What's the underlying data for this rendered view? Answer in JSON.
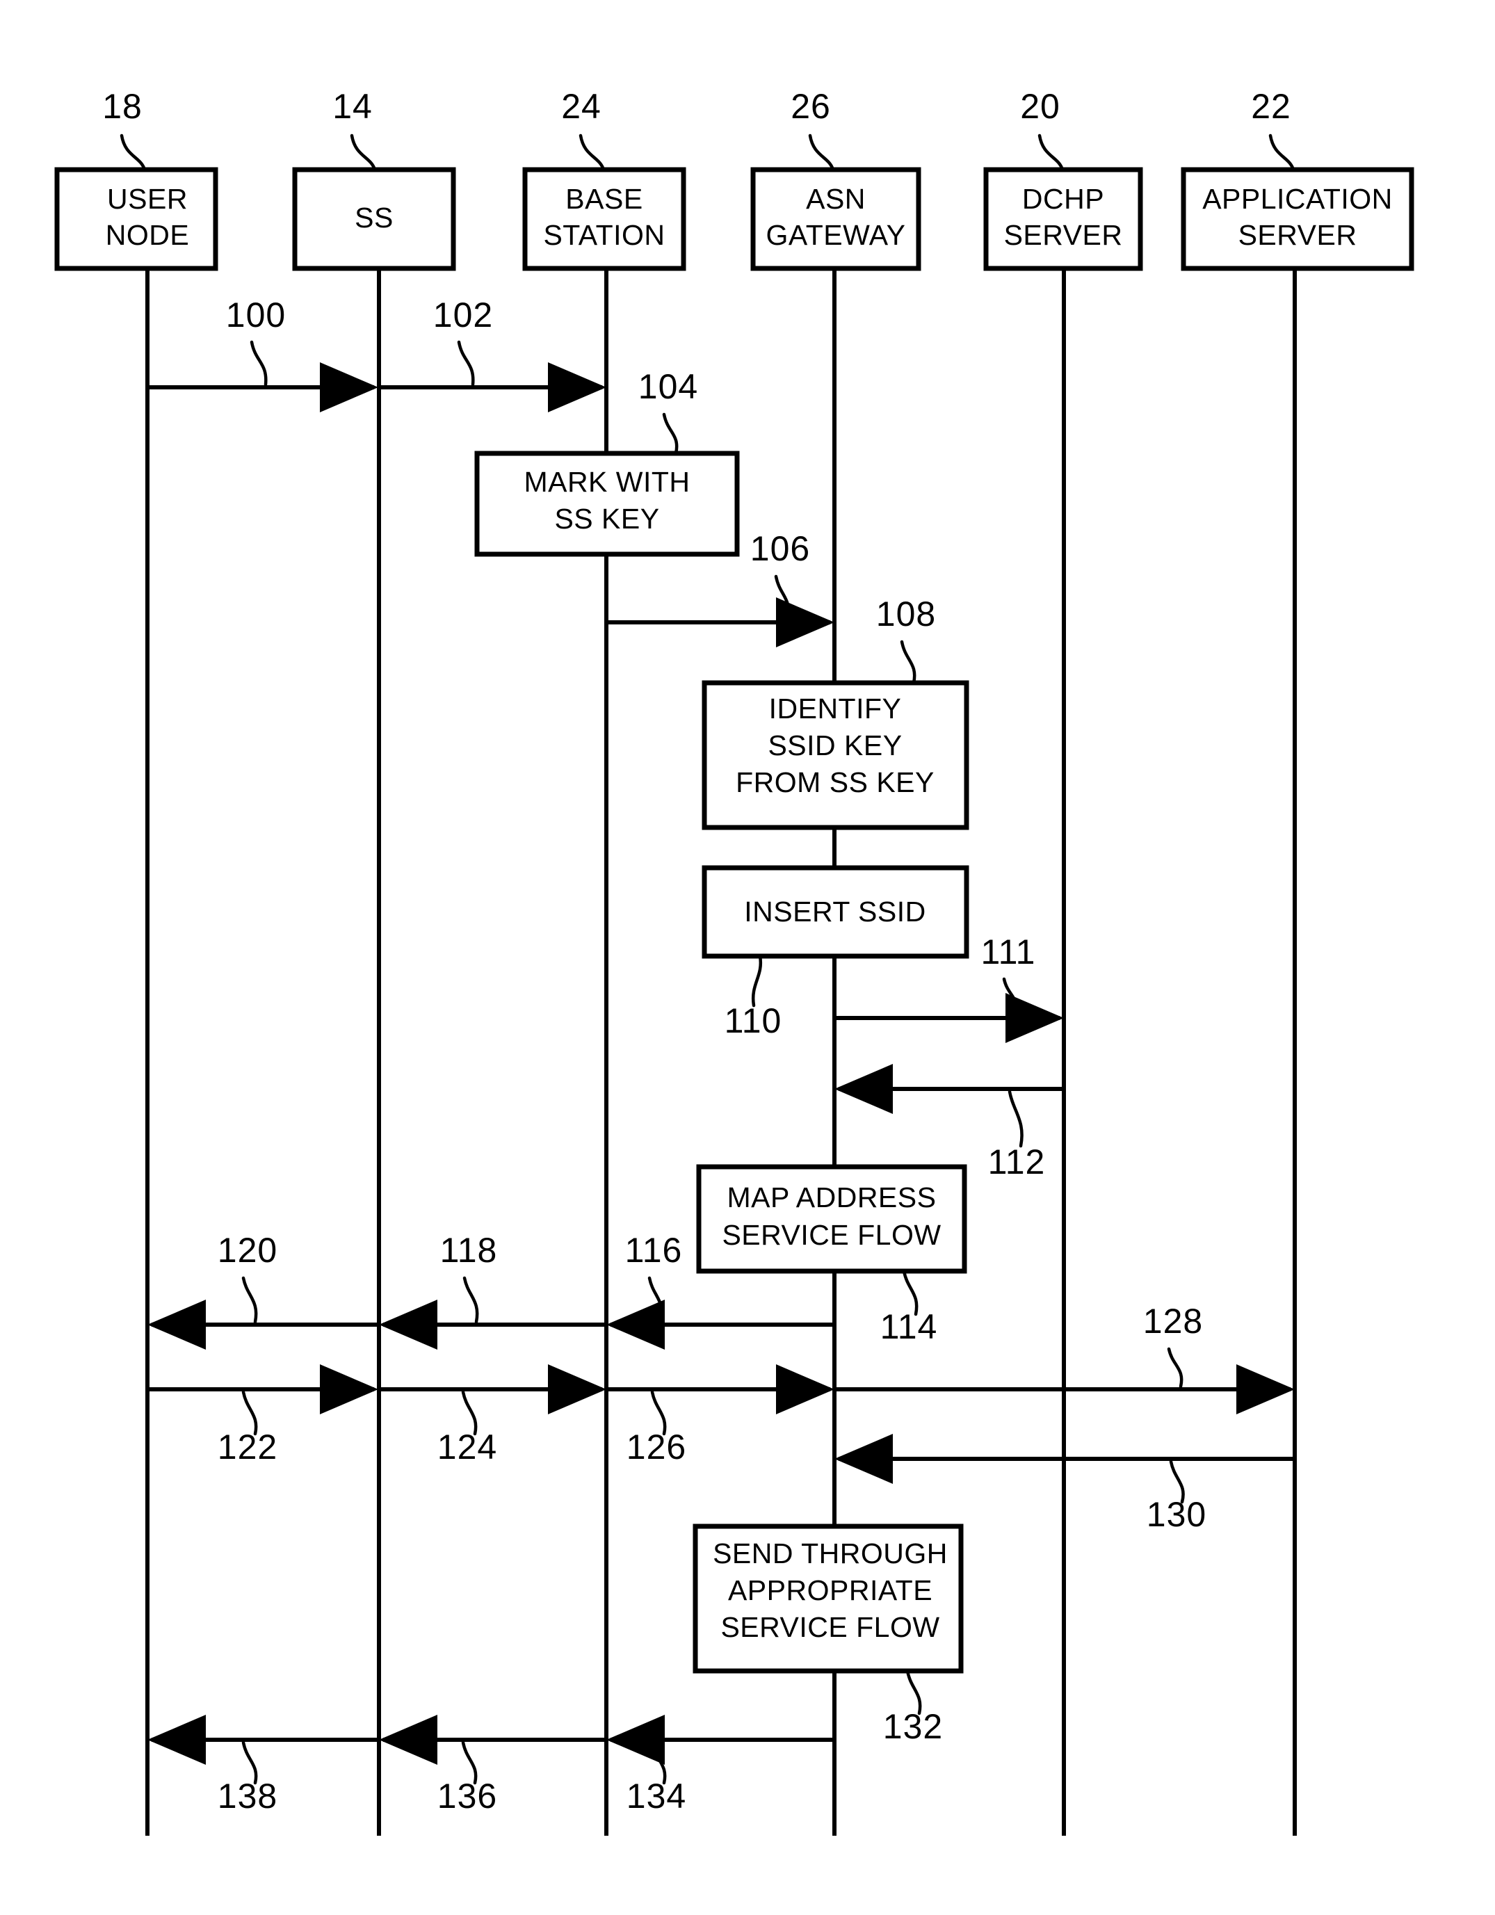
{
  "figure": {
    "type": "sequence-diagram",
    "kind": "patent-drawing",
    "background_color": "#ffffff",
    "line_color": "#000000"
  },
  "lifelines": [
    {
      "ref": "18",
      "label_line1": "USER",
      "label_line2": "NODE"
    },
    {
      "ref": "14",
      "label_line1": "SS",
      "label_line2": ""
    },
    {
      "ref": "24",
      "label_line1": "BASE",
      "label_line2": "STATION"
    },
    {
      "ref": "26",
      "label_line1": "ASN",
      "label_line2": "GATEWAY"
    },
    {
      "ref": "20",
      "label_line1": "DCHP",
      "label_line2": "SERVER"
    },
    {
      "ref": "22",
      "label_line1": "APPLICATION",
      "label_line2": "SERVER"
    }
  ],
  "process_boxes": [
    {
      "ref": "104",
      "lines": [
        "MARK WITH",
        "SS KEY"
      ]
    },
    {
      "ref": "108",
      "lines": [
        "IDENTIFY",
        "SSID KEY",
        "FROM SS KEY"
      ]
    },
    {
      "ref": "110",
      "lines": [
        "INSERT SSID"
      ]
    },
    {
      "ref": "114",
      "lines": [
        "MAP ADDRESS",
        "SERVICE FLOW"
      ]
    },
    {
      "ref": "132",
      "lines": [
        "SEND THROUGH",
        "APPROPRIATE",
        "SERVICE FLOW"
      ]
    }
  ],
  "messages": [
    {
      "ref": "100",
      "from": "USER NODE",
      "to": "SS",
      "direction": "right"
    },
    {
      "ref": "102",
      "from": "SS",
      "to": "BASE STATION",
      "direction": "right"
    },
    {
      "ref": "106",
      "from": "BASE STATION",
      "to": "ASN GATEWAY",
      "direction": "right"
    },
    {
      "ref": "111",
      "from": "ASN GATEWAY",
      "to": "DCHP SERVER",
      "direction": "right"
    },
    {
      "ref": "112",
      "from": "DCHP SERVER",
      "to": "ASN GATEWAY",
      "direction": "left"
    },
    {
      "ref": "116",
      "from": "ASN GATEWAY",
      "to": "BASE STATION",
      "direction": "left"
    },
    {
      "ref": "118",
      "from": "BASE STATION",
      "to": "SS",
      "direction": "left"
    },
    {
      "ref": "120",
      "from": "SS",
      "to": "USER NODE",
      "direction": "left"
    },
    {
      "ref": "122",
      "from": "USER NODE",
      "to": "SS",
      "direction": "right"
    },
    {
      "ref": "124",
      "from": "SS",
      "to": "BASE STATION",
      "direction": "right"
    },
    {
      "ref": "126",
      "from": "BASE STATION",
      "to": "ASN GATEWAY",
      "direction": "right"
    },
    {
      "ref": "128",
      "from": "ASN GATEWAY",
      "to": "APPLICATION SERVER",
      "direction": "right"
    },
    {
      "ref": "130",
      "from": "APPLICATION SERVER",
      "to": "ASN GATEWAY",
      "direction": "left"
    },
    {
      "ref": "134",
      "from": "ASN GATEWAY",
      "to": "BASE STATION",
      "direction": "left"
    },
    {
      "ref": "136",
      "from": "BASE STATION",
      "to": "SS",
      "direction": "left"
    },
    {
      "ref": "138",
      "from": "SS",
      "to": "USER NODE",
      "direction": "left"
    }
  ],
  "reference_numerals": [
    "18",
    "14",
    "24",
    "26",
    "20",
    "22",
    "100",
    "102",
    "104",
    "106",
    "108",
    "110",
    "111",
    "112",
    "114",
    "116",
    "118",
    "120",
    "122",
    "124",
    "126",
    "128",
    "130",
    "132",
    "134",
    "136",
    "138"
  ]
}
